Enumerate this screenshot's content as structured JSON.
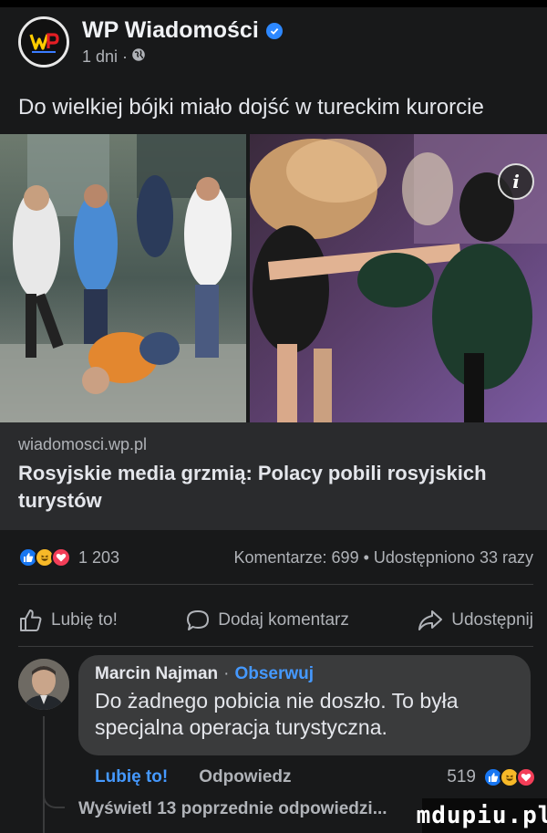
{
  "post": {
    "page_name": "WP Wiadomości",
    "time_ago": "1 dni",
    "dot": "·",
    "text": "Do wielkiej bójki miało dojść w tureckim kurorcie"
  },
  "link_card": {
    "domain": "wiadomosci.wp.pl",
    "title": "Rosyjskie media grzmią: Polacy pobili rosyjskich turystów"
  },
  "stats": {
    "reaction_count": "1 203",
    "comments_shares": "Komentarze: 699 • Udostępniono 33 razy"
  },
  "actions": {
    "like": "Lubię to!",
    "comment": "Dodaj komentarz",
    "share": "Udostępnij"
  },
  "comment": {
    "author": "Marcin Najman",
    "separator": "·",
    "follow": "Obserwuj",
    "text_line1": "Do żadnego pobicia nie doszło. To była",
    "text_line2": "specjalna operacja turystyczna.",
    "like": "Lubię to!",
    "reply": "Odpowiedz",
    "reaction_count": "519"
  },
  "view_replies": "Wyświetl 13 poprzednie odpowiedzi...",
  "watermark": "mdupiu.pl",
  "colors": {
    "background": "#18191a",
    "card": "#2a2b2d",
    "bubble": "#3a3b3c",
    "link_blue": "#4599ff",
    "like_blue": "#1877f2",
    "haha_yellow": "#f7b928",
    "love_red": "#f33e58"
  },
  "icons": [
    "verified-icon",
    "globe-icon",
    "info-icon",
    "like-icon",
    "comment-icon",
    "share-icon"
  ]
}
